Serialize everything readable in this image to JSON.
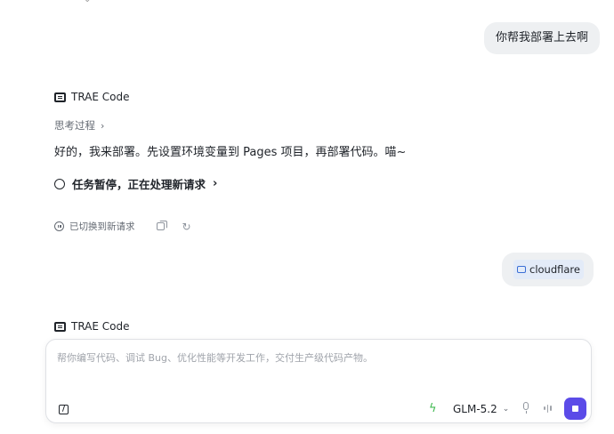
{
  "conversation": {
    "user_message_1": "你帮我部署上去啊",
    "assistant_1": {
      "name": "TRAE Code",
      "thinking_label": "思考过程",
      "answer": "好的，我来部署。先设置环境变量到 Pages 项目，再部署代码。喵~",
      "task_status": "任务暂停，正在处理新请求",
      "switched_label": "已切换到新请求"
    },
    "user_message_2_chip": "cloudflare",
    "assistant_2": {
      "name": "TRAE Code"
    }
  },
  "input": {
    "placeholder": "帮你编写代码、调试 Bug、优化性能等开发工作，交付生产级代码产物。",
    "value": "",
    "model": "GLM-5.2"
  },
  "icons": {
    "brand": "trae-logo-icon",
    "thinking_chevron": "chevron-right-icon",
    "task": "circle-icon",
    "task_chevron": "chevron-right-icon",
    "paused": "pause-circle-icon",
    "copy": "copy-icon",
    "retry": "refresh-icon",
    "cloudflare": "link-chip-icon",
    "slash": "slash-command-icon",
    "mode": "lightning-icon",
    "model_chevron": "chevron-down-icon",
    "mic": "microphone-icon",
    "voice": "waveform-icon",
    "stop": "stop-icon"
  },
  "colors": {
    "accent": "#5b4be8",
    "bubble": "#eef0f2",
    "chip": "#e3ebf8",
    "bolt": "#3fb950"
  }
}
